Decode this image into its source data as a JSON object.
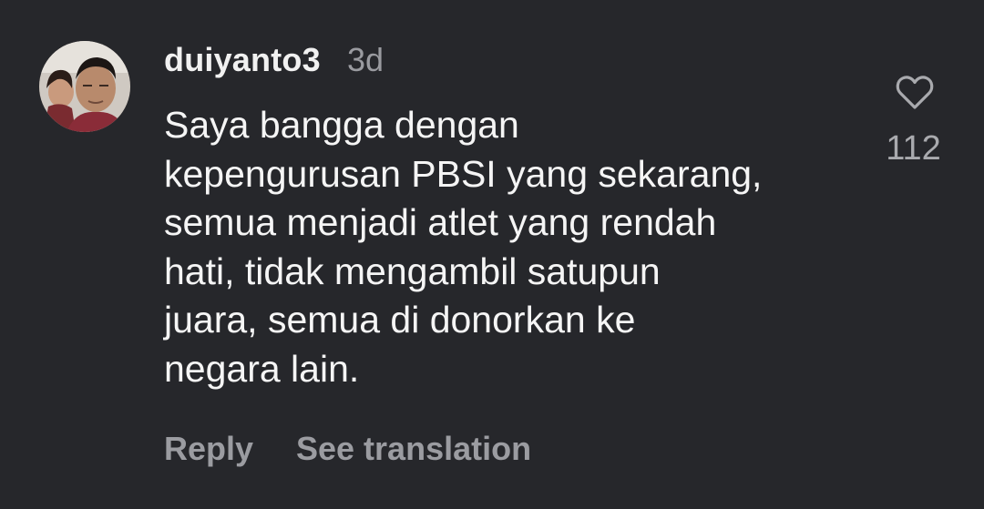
{
  "comment": {
    "username": "duiyanto3",
    "timestamp": "3d",
    "text_lines": [
      "Saya bangga dengan",
      "kepengurusan PBSI yang sekarang,",
      "semua menjadi atlet yang rendah",
      "hati, tidak mengambil satupun",
      "juara, semua di donorkan ke",
      "negara lain."
    ],
    "like_count": "112",
    "like_icon": "heart-outline-icon",
    "avatar": "user-avatar-photo"
  },
  "actions": {
    "reply_label": "Reply",
    "translate_label": "See translation"
  },
  "colors": {
    "background": "#26272b",
    "primary_text": "#f5f5f5",
    "secondary_text": "#9b9ca1"
  }
}
